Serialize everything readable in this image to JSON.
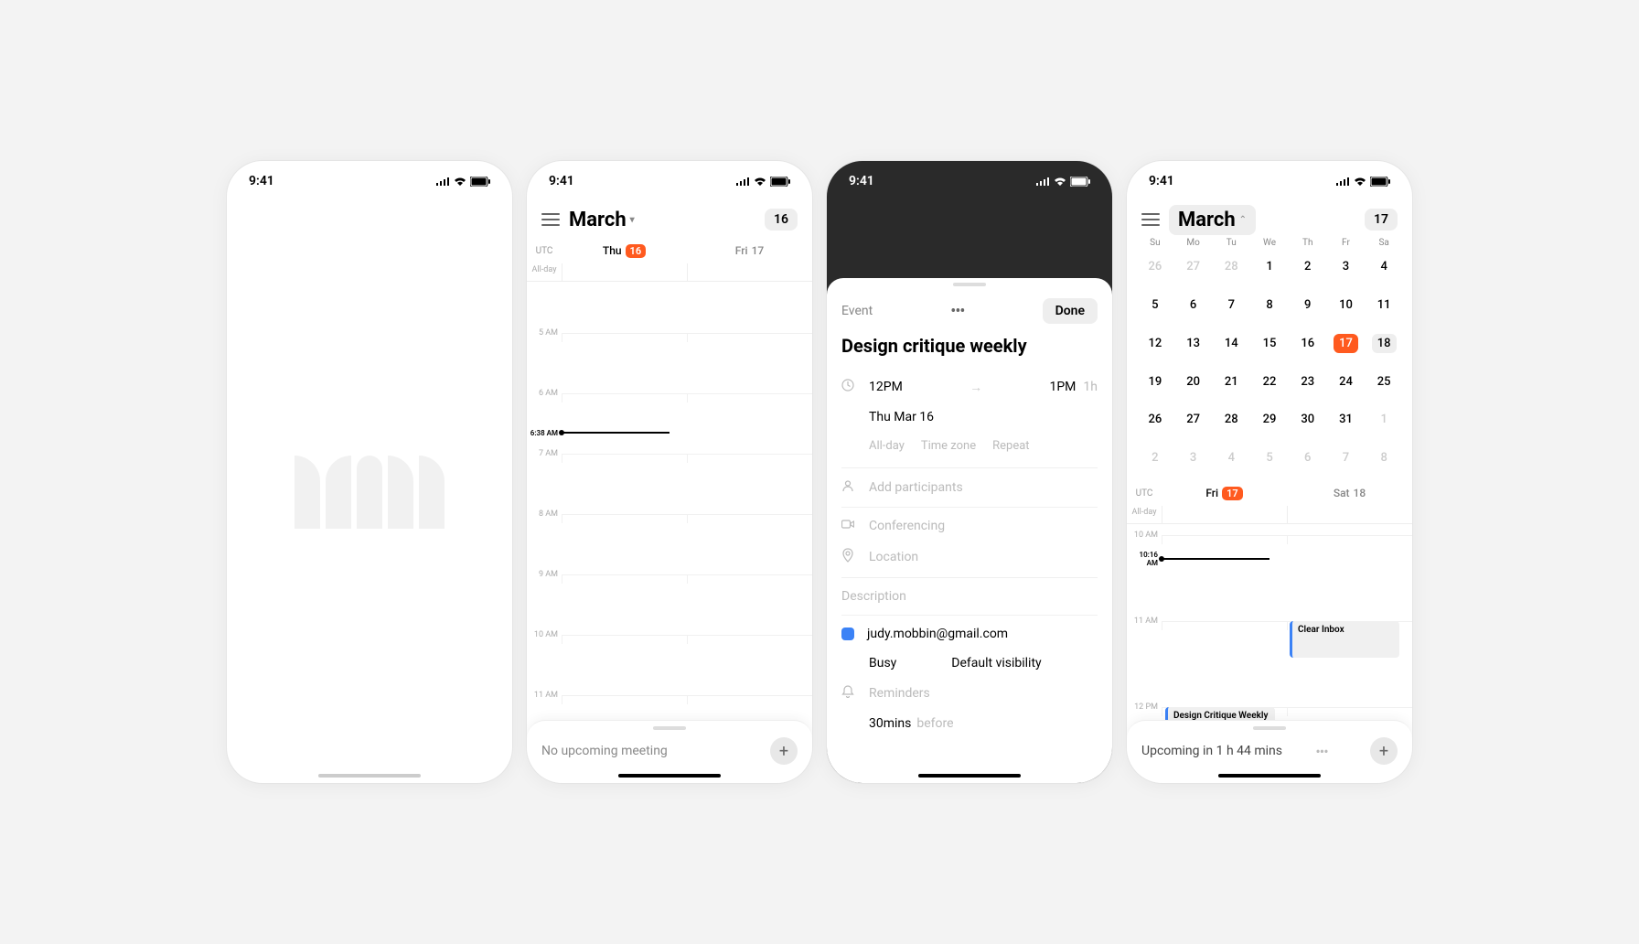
{
  "status": {
    "time": "9:41"
  },
  "screen2": {
    "month": "March",
    "chip": "16",
    "tz": "UTC",
    "days": [
      {
        "label": "Thu",
        "num": "16",
        "active": true
      },
      {
        "label": "Fri",
        "num": "17",
        "active": false
      }
    ],
    "allday": "All-day",
    "hours": [
      "5 AM",
      "6 AM",
      "7 AM",
      "8 AM",
      "9 AM",
      "10 AM",
      "11 AM"
    ],
    "now": "6:38 AM",
    "upcoming": "No upcoming meeting"
  },
  "screen3": {
    "label": "Event",
    "done": "Done",
    "title": "Design critique weekly",
    "start": "12PM",
    "end": "1PM",
    "duration": "1h",
    "date": "Thu Mar 16",
    "options": [
      "All-day",
      "Time zone",
      "Repeat"
    ],
    "participants": "Add participants",
    "conferencing": "Conferencing",
    "location": "Location",
    "description": "Description",
    "calendar": "judy.mobbin@gmail.com",
    "busy": "Busy",
    "visibility": "Default visibility",
    "reminders": "Reminders",
    "reminder_time": "30mins",
    "reminder_suffix": "before"
  },
  "screen4": {
    "month": "March",
    "chip": "17",
    "weekdays": [
      "Su",
      "Mo",
      "Tu",
      "We",
      "Th",
      "Fr",
      "Sa"
    ],
    "rows": [
      [
        {
          "d": "26",
          "o": true
        },
        {
          "d": "27",
          "o": true
        },
        {
          "d": "28",
          "o": true
        },
        {
          "d": "1"
        },
        {
          "d": "2"
        },
        {
          "d": "3"
        },
        {
          "d": "4"
        }
      ],
      [
        {
          "d": "5"
        },
        {
          "d": "6"
        },
        {
          "d": "7"
        },
        {
          "d": "8"
        },
        {
          "d": "9"
        },
        {
          "d": "10"
        },
        {
          "d": "11"
        }
      ],
      [
        {
          "d": "12"
        },
        {
          "d": "13"
        },
        {
          "d": "14"
        },
        {
          "d": "15"
        },
        {
          "d": "16"
        },
        {
          "d": "17",
          "t": true
        },
        {
          "d": "18",
          "s": true
        }
      ],
      [
        {
          "d": "19"
        },
        {
          "d": "20"
        },
        {
          "d": "21"
        },
        {
          "d": "22"
        },
        {
          "d": "23"
        },
        {
          "d": "24"
        },
        {
          "d": "25"
        }
      ],
      [
        {
          "d": "26"
        },
        {
          "d": "27"
        },
        {
          "d": "28"
        },
        {
          "d": "29"
        },
        {
          "d": "30"
        },
        {
          "d": "31"
        },
        {
          "d": "1",
          "o": true
        }
      ],
      [
        {
          "d": "2",
          "o": true
        },
        {
          "d": "3",
          "o": true
        },
        {
          "d": "4",
          "o": true
        },
        {
          "d": "5",
          "o": true
        },
        {
          "d": "6",
          "o": true
        },
        {
          "d": "7",
          "o": true
        },
        {
          "d": "8",
          "o": true
        }
      ]
    ],
    "tz": "UTC",
    "dayheader": [
      {
        "label": "Fri",
        "num": "17",
        "active": true
      },
      {
        "label": "Sat",
        "num": "18",
        "active": false
      }
    ],
    "allday": "All-day",
    "hours": [
      "10 AM",
      "11 AM",
      "12 PM"
    ],
    "now": "10:16 AM",
    "events": [
      {
        "title": "Clear Inbox"
      },
      {
        "title": "Design Critique Weekly"
      }
    ],
    "upcoming": "Upcoming in 1 h 44 mins"
  }
}
